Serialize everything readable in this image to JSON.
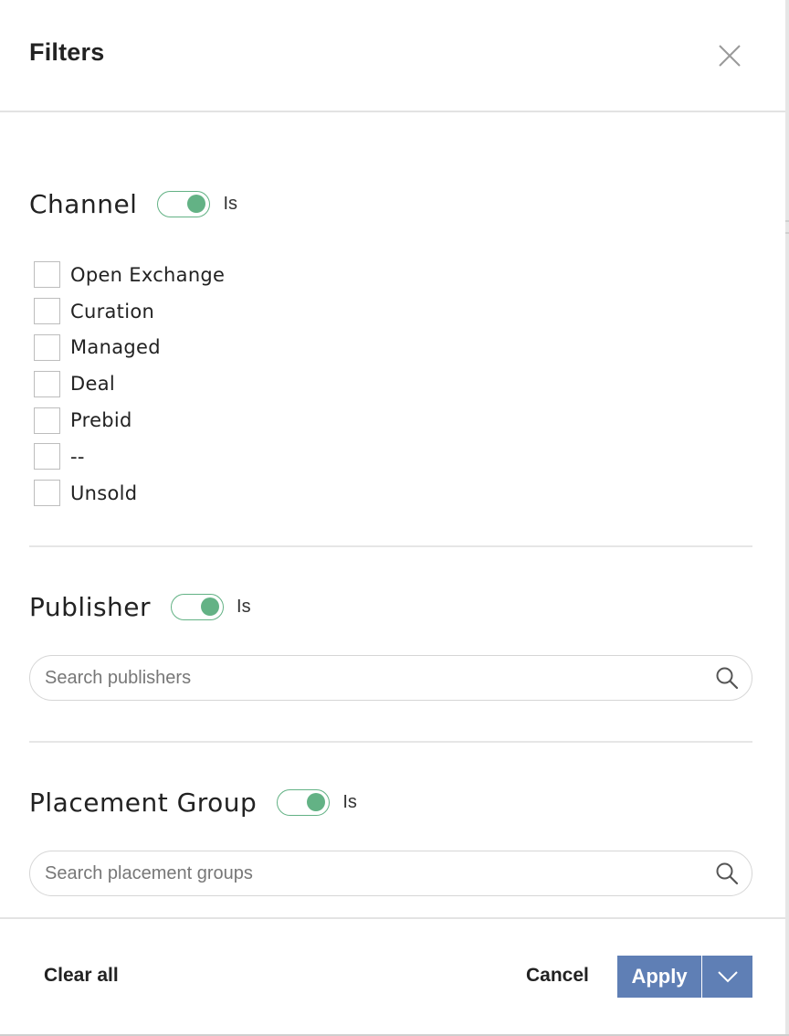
{
  "header": {
    "title": "Filters",
    "close_icon": "close-icon"
  },
  "sections": {
    "channel": {
      "title": "Channel",
      "toggle_on": true,
      "toggle_label": "Is",
      "options": [
        {
          "label": "Open Exchange",
          "checked": false
        },
        {
          "label": "Curation",
          "checked": false
        },
        {
          "label": "Managed",
          "checked": false
        },
        {
          "label": "Deal",
          "checked": false
        },
        {
          "label": "Prebid",
          "checked": false
        },
        {
          "label": "--",
          "checked": false
        },
        {
          "label": "Unsold",
          "checked": false
        }
      ]
    },
    "publisher": {
      "title": "Publisher",
      "toggle_on": true,
      "toggle_label": "Is",
      "search_placeholder": "Search publishers",
      "search_value": ""
    },
    "placement_group": {
      "title": "Placement Group",
      "toggle_on": true,
      "toggle_label": "Is",
      "search_placeholder": "Search placement groups",
      "search_value": ""
    }
  },
  "footer": {
    "clear_all_label": "Clear all",
    "cancel_label": "Cancel",
    "apply_label": "Apply",
    "apply_dropdown_icon": "chevron-down-icon"
  },
  "colors": {
    "toggle_accent": "#63b285",
    "apply_button": "#5f7fb5"
  }
}
